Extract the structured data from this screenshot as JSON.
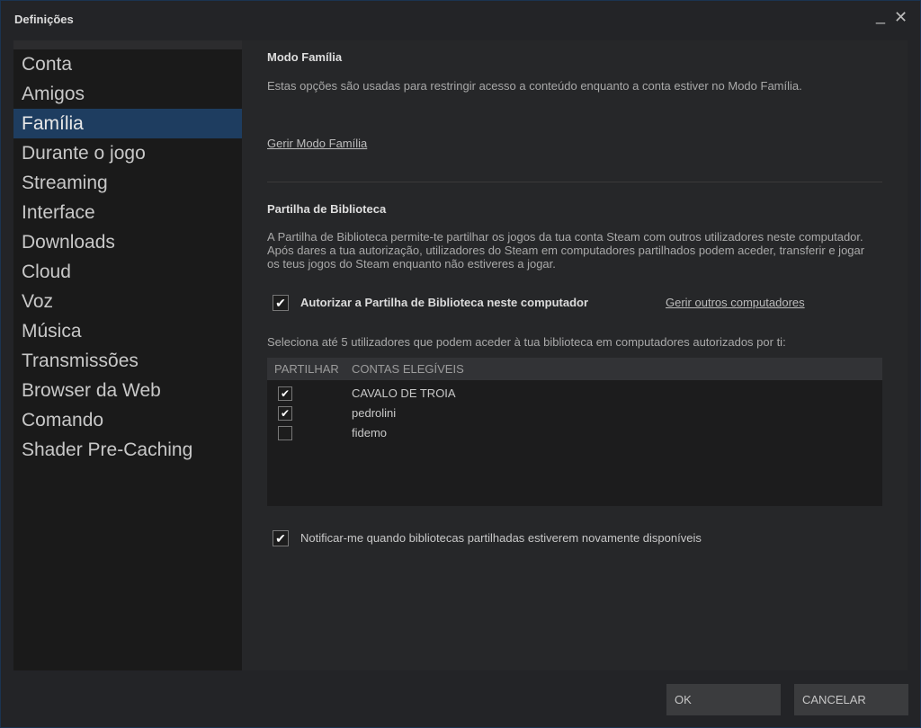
{
  "window": {
    "title": "Definições",
    "minimize_icon": "_",
    "close_icon": "✕"
  },
  "sidebar": {
    "items": [
      "Conta",
      "Amigos",
      "Família",
      "Durante o jogo",
      "Streaming",
      "Interface",
      "Downloads",
      "Cloud",
      "Voz",
      "Música",
      "Transmissões",
      "Browser da Web",
      "Comando",
      "Shader Pre-Caching"
    ],
    "selected": "Família"
  },
  "family": {
    "title": "Modo Família",
    "description": "Estas opções são usadas para restringir acesso a conteúdo enquanto a conta estiver no Modo Família.",
    "manage_link": "Gerir Modo Família"
  },
  "library": {
    "title": "Partilha de Biblioteca",
    "description": "A Partilha de Biblioteca permite-te partilhar os jogos da tua conta Steam com outros utilizadores neste computador. Após dares a tua autorização, utilizadores do Steam em computadores partilhados podem aceder, transferir e jogar os teus jogos do Steam enquanto não estiveres a jogar.",
    "authorize_label": "Autorizar a Partilha de Biblioteca neste computador",
    "authorize_checked": true,
    "manage_other_link": "Gerir outros computadores",
    "select_hint": "Seleciona até 5 utilizadores que podem aceder à tua biblioteca em computadores autorizados por ti:",
    "table": {
      "columns": [
        "PARTILHAR",
        "CONTAS ELEGÍVEIS"
      ],
      "rows": [
        {
          "name": "CAVALO DE TROIA",
          "checked": true
        },
        {
          "name": "pedrolini",
          "checked": true
        },
        {
          "name": "fidemo",
          "checked": false
        }
      ]
    },
    "notify_label": "Notificar-me quando bibliotecas partilhadas estiverem novamente disponíveis",
    "notify_checked": true
  },
  "buttons": {
    "ok": "OK",
    "cancel": "CANCELAR"
  },
  "colors": {
    "selected": "#1e3d60"
  }
}
